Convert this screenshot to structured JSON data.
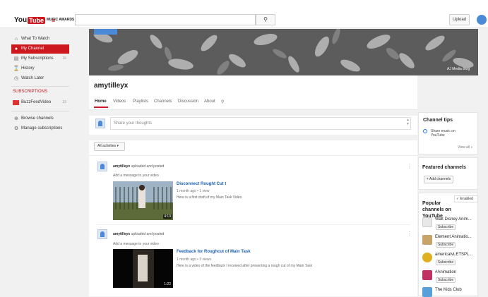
{
  "header": {
    "logo_you": "You",
    "logo_tube": "Tube",
    "logo_sub": "MUSIC AWARDS",
    "menu_glyph": "≡",
    "search_placeholder": "",
    "search_glyph": "⚲",
    "upload_label": "Upload"
  },
  "sidebar": {
    "items": [
      {
        "label": "What To Watch",
        "icon": "home-icon",
        "glyph": "⌂"
      },
      {
        "label": "My Channel",
        "icon": "user-icon",
        "glyph": "●"
      },
      {
        "label": "My Subscriptions",
        "icon": "subscriptions-icon",
        "glyph": "▤",
        "count": "16"
      },
      {
        "label": "History",
        "icon": "hourglass-icon",
        "glyph": "⌛"
      },
      {
        "label": "Watch Later",
        "icon": "clock-icon",
        "glyph": "◷"
      }
    ],
    "subscriptions_heading": "SUBSCRIPTIONS",
    "subscriptions": [
      {
        "label": "BuzzFeedVideo",
        "count": "23"
      }
    ],
    "footer_items": [
      {
        "label": "Browse channels",
        "icon": "plus-circle-icon",
        "glyph": "⊕"
      },
      {
        "label": "Manage subscriptions",
        "icon": "gear-icon",
        "glyph": "⚙"
      }
    ]
  },
  "banner": {
    "credit": "AJ Media Blog"
  },
  "channel": {
    "name": "amytilleyx",
    "tabs": [
      "Home",
      "Videos",
      "Playlists",
      "Channels",
      "Discussion",
      "About"
    ],
    "search_glyph": "⚲"
  },
  "share": {
    "placeholder": "Share your thoughts"
  },
  "feed": {
    "filter_label": "All activities ▾",
    "posts": [
      {
        "user": "amytilleyx",
        "action": "uploaded and posted",
        "message": "Add a message to your video",
        "video_title": "Disconnect Rought Cut t",
        "meta": "1 month ago • 1 view",
        "description": "Here is a first draft of my Main Task Video",
        "duration": "4:19"
      },
      {
        "user": "amytilleyx",
        "action": "uploaded and posted",
        "message": "Add a message to your video",
        "video_title": "Feedback for Roughcut of Main Task",
        "meta": "1 month ago • 3 views",
        "description": "Here is a video of the feedback I received after presenting a rough cut of my Main Task",
        "duration": "1:22"
      }
    ],
    "more_glyph": "⋮"
  },
  "right": {
    "tips_title": "Channel tips",
    "tip_text": "Share music on YouTube",
    "view_all": "View all »",
    "featured_title": "Featured channels",
    "add_channels": "+ Add channels",
    "enabled_label": "✓ Enabled",
    "popular_title": "Popular channels on YouTube",
    "popular": [
      {
        "name": "Walt Disney Anim...",
        "subscribe": "Subscribe",
        "color": "#e8e8e8"
      },
      {
        "name": "Element Animatio...",
        "subscribe": "Subscribe",
        "color": "#c8a46a"
      },
      {
        "name": "americatvLETSPL...",
        "subscribe": "Subscribe",
        "color": "#e0b020"
      },
      {
        "name": "#Animation",
        "subscribe": "Subscribe",
        "color": "#c03060"
      },
      {
        "name": "The Kids Club",
        "subscribe": "",
        "color": "#5aa0d8"
      }
    ]
  },
  "colors": {
    "accent": "#cc181e",
    "link": "#1b5fb3"
  }
}
